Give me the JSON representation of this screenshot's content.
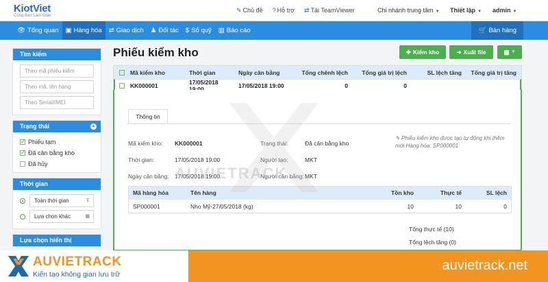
{
  "topbar": {
    "logo": "KiotViet",
    "logo_sub": "Cùng Bạn Làm Giàu",
    "links": [
      "Chủ đề",
      "Hỗ trợ",
      "Tải TeamViewer"
    ],
    "branch": "Chi nhánh trung tâm",
    "setup": "Thiết lập",
    "user": "admin"
  },
  "nav": {
    "items": [
      "Tổng quan",
      "Hàng hóa",
      "Giao dịch",
      "Đối tác",
      "Sổ quỹ",
      "Báo cáo"
    ],
    "active": "Hàng hóa",
    "sell": "Bán hàng"
  },
  "sidebar": {
    "search_title": "Tìm kiếm",
    "search_placeholders": [
      "Theo mã phiếu kiểm",
      "Theo mã, tên hàng",
      "Theo Serial/IMEI"
    ],
    "status_title": "Trạng thái",
    "status_options": [
      {
        "label": "Phiếu tạm",
        "checked": true
      },
      {
        "label": "Đã cân bằng kho",
        "checked": true
      },
      {
        "label": "Đã hủy",
        "checked": false
      }
    ],
    "time_title": "Thời gian",
    "time_options": [
      "Toàn thời gian",
      "Lựa chọn khác"
    ],
    "display_title": "Lựa chọn hiển thị"
  },
  "main": {
    "title": "Phiếu kiểm kho",
    "btn_check": "Kiểm kho",
    "btn_export": "Xuất file",
    "columns": [
      "Mã kiểm kho",
      "Thời gian",
      "Ngày cân bằng",
      "Tổng chênh lệch",
      "Tổng giá trị lệch",
      "SL lệch tăng",
      "Tổng giá trị tăng"
    ],
    "row": {
      "code": "KK000001",
      "time": "17/05/2018 19:00",
      "balance_date": "17/05/2018 19:00",
      "total_diff": "0",
      "total_diff_value": "0"
    }
  },
  "detail": {
    "tab": "Thông tin",
    "labels": {
      "code": "Mã kiểm kho:",
      "time": "Thời gian:",
      "balance_date": "Ngày cân bằng:",
      "status": "Trạng thái:",
      "creator": "Người tạo:",
      "balancer": "Người cân bằng:"
    },
    "values": {
      "code": "KK000001",
      "time": "17/05/2018 19:00",
      "balance_date": "17/05/2018 19:00",
      "status": "Đã cân bằng kho",
      "creator": "MKT",
      "balancer": "MKT"
    },
    "note": "Phiếu kiểm kho được tạo tự động khi thêm mới Hàng hóa: SP000001",
    "sub_columns": [
      "Mã hàng hóa",
      "Tên hàng",
      "Tồn kho",
      "Thực tế",
      "SL lệch"
    ],
    "sub_row": {
      "code": "SP000001",
      "name": "Nho Mỹ-27/05/2018 (kg)",
      "stock": "10",
      "actual": "10",
      "diff": "0"
    },
    "total_actual": "Tổng thực tế (10)",
    "total_increase": "Tổng lệch tăng (0)"
  },
  "watermark": "AUVIETRACK",
  "footer": {
    "brand": "AUVIETRACK",
    "tagline": "Kiến tạo không gian lưu trữ",
    "site": "auvietrack.net"
  },
  "colors": {
    "primary": "#2b8de0",
    "green": "#4cae4c",
    "orange": "#f39420"
  }
}
